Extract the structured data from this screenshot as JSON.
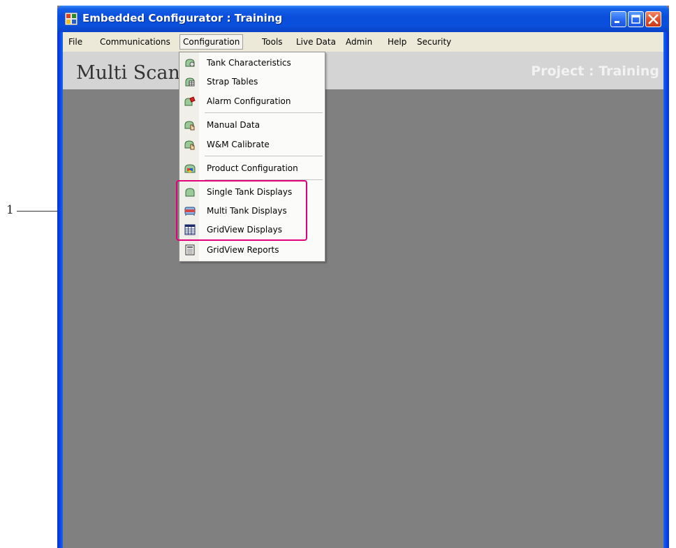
{
  "window": {
    "title": "Embedded Configurator : Training"
  },
  "menubar": {
    "items": [
      "File",
      "Communications",
      "Configuration",
      "Tools",
      "Live Data",
      "Admin",
      "Help",
      "Security"
    ],
    "active": "Configuration"
  },
  "header": {
    "app_name": "Multi Scan",
    "project": "Project : Training"
  },
  "dropdown": {
    "items": [
      {
        "label": "Tank Characteristics",
        "icon": "tank-characteristics-icon"
      },
      {
        "label": "Strap Tables",
        "icon": "strap-tables-icon"
      },
      {
        "label": "Alarm Configuration",
        "icon": "alarm-configuration-icon"
      },
      {
        "label": "Manual Data",
        "icon": "manual-data-icon"
      },
      {
        "label": "W&M Calibrate",
        "icon": "wm-calibrate-icon"
      },
      {
        "label": "Product Configuration",
        "icon": "product-configuration-icon"
      },
      {
        "label": "Single Tank Displays",
        "icon": "single-tank-displays-icon"
      },
      {
        "label": "Multi Tank Displays",
        "icon": "multi-tank-displays-icon"
      },
      {
        "label": "GridView Displays",
        "icon": "gridview-displays-icon"
      },
      {
        "label": "GridView Reports",
        "icon": "gridview-reports-icon"
      }
    ]
  },
  "callout": {
    "label": "1",
    "highlight_color": "#e0007a"
  },
  "colors": {
    "titlebar": "#0a4fdc",
    "workspace": "#808080",
    "menubar": "#ece9d8"
  }
}
